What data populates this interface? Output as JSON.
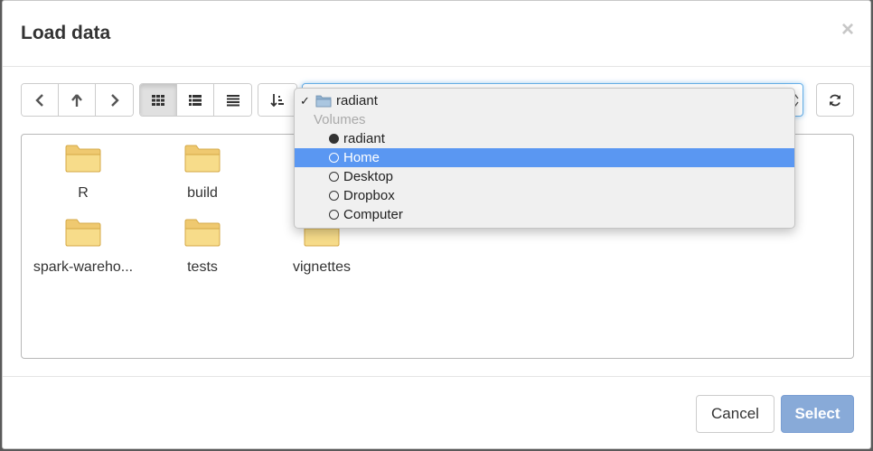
{
  "modal": {
    "title": "Load data",
    "close_label": "×"
  },
  "toolbar": {
    "nav_buttons": [
      "chevron-left-icon",
      "arrow-up-icon",
      "chevron-right-icon"
    ],
    "view_buttons": [
      "grid-view-icon",
      "list-view-icon",
      "detail-view-icon"
    ],
    "active_view": "grid-view-icon",
    "sort_button": "sort-icon",
    "refresh_button": "refresh-icon"
  },
  "path_dropdown": {
    "current": "radiant",
    "section_label": "Volumes",
    "options": [
      {
        "label": "radiant",
        "selected": true,
        "highlighted": false
      },
      {
        "label": "Home",
        "selected": false,
        "highlighted": true
      },
      {
        "label": "Desktop",
        "selected": false,
        "highlighted": false
      },
      {
        "label": "Dropbox",
        "selected": false,
        "highlighted": false
      },
      {
        "label": "Computer",
        "selected": false,
        "highlighted": false
      }
    ]
  },
  "files": [
    {
      "name": "R"
    },
    {
      "name": "build"
    },
    {
      "name": ""
    },
    {
      "name": "spark-wareho..."
    },
    {
      "name": "tests"
    },
    {
      "name": "vignettes"
    }
  ],
  "footer": {
    "cancel_label": "Cancel",
    "select_label": "Select"
  },
  "colors": {
    "accent": "#5a97f2",
    "select_button": "#88aad8",
    "folder": "#f7dc8a"
  }
}
